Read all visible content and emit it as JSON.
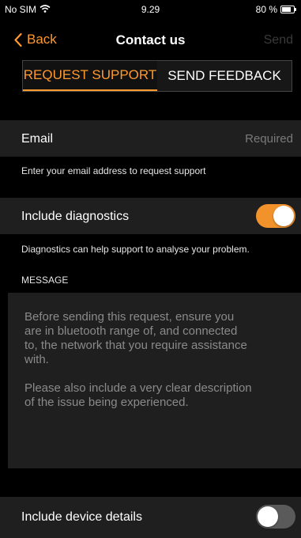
{
  "status_bar": {
    "carrier": "No SIM",
    "time": "9.29",
    "battery_percent_label": "80 %",
    "battery_level": 0.8
  },
  "nav": {
    "back_label": "Back",
    "title": "Contact us",
    "send_label": "Send"
  },
  "tabs": [
    {
      "label": "REQUEST SUPPORT",
      "selected": true
    },
    {
      "label": "SEND FEEDBACK",
      "selected": false
    }
  ],
  "email": {
    "label": "Email",
    "placeholder": "Required",
    "footer": "Enter your email address to request support"
  },
  "diagnostics": {
    "label": "Include diagnostics",
    "enabled": true,
    "footer": "Diagnostics can help support to analyse your problem."
  },
  "message": {
    "section_title": "MESSAGE",
    "placeholder": "Before sending this request, ensure you are in bluetooth range of, and connected to, the network that you require assistance with.\n\nPlease also include a very clear description of the issue being experienced."
  },
  "device_details": {
    "label": "Include device details",
    "enabled": false
  },
  "colors": {
    "accent": "#ff9a2e",
    "row_background": "#1f1f1f",
    "toggle_on": "#f2922b",
    "toggle_off": "#5a5a5a"
  }
}
